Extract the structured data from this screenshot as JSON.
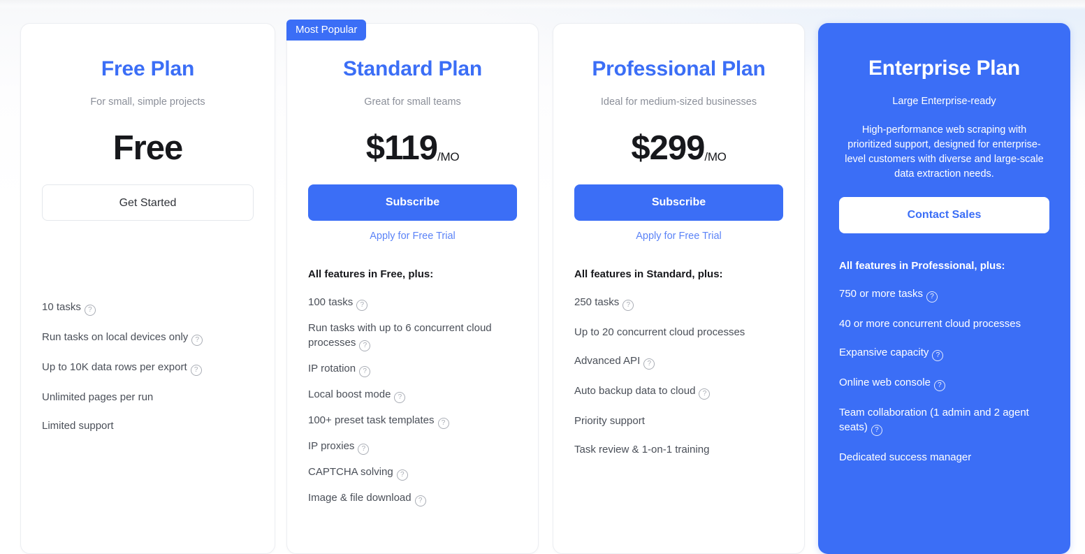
{
  "colors": {
    "brand_blue": "#3b6ef6",
    "link_blue": "#5b83f7",
    "text_dark": "#17181c",
    "text_body": "#4a4f58",
    "muted": "#8b8f99"
  },
  "help_icon_glyph": "?",
  "plans": [
    {
      "id": "free",
      "title": "Free Plan",
      "tagline": "For small, simple projects",
      "price_display": "Free",
      "price_unit": "",
      "cta_label": "Get Started",
      "cta_style": "outline",
      "trial_link": "",
      "features_head": "",
      "features": [
        {
          "text": "10 tasks",
          "help": true
        },
        {
          "text": "Run tasks on local devices only",
          "help": true
        },
        {
          "text": "Up to 10K data rows per export",
          "help": true
        },
        {
          "text": "Unlimited pages per run",
          "help": false
        },
        {
          "text": "Limited support",
          "help": false
        }
      ]
    },
    {
      "id": "standard",
      "badge": "Most Popular",
      "title": "Standard Plan",
      "tagline": "Great for small teams",
      "price_display": "$119",
      "price_unit": "/MO",
      "cta_label": "Subscribe",
      "cta_style": "primary",
      "trial_link": "Apply for Free Trial",
      "features_head": "All features in Free, plus:",
      "features": [
        {
          "text": "100 tasks",
          "help": true
        },
        {
          "text": "Run tasks with up to 6 concurrent cloud processes",
          "help": true
        },
        {
          "text": "IP rotation",
          "help": true
        },
        {
          "text": "Local boost mode",
          "help": true
        },
        {
          "text": "100+ preset task templates",
          "help": true
        },
        {
          "text": "IP proxies",
          "help": true
        },
        {
          "text": "CAPTCHA solving",
          "help": true
        },
        {
          "text": "Image & file download",
          "help": true
        }
      ]
    },
    {
      "id": "professional",
      "title": "Professional Plan",
      "tagline": "Ideal for medium-sized businesses",
      "price_display": "$299",
      "price_unit": "/MO",
      "cta_label": "Subscribe",
      "cta_style": "primary",
      "trial_link": "Apply for Free Trial",
      "features_head": "All features in Standard, plus:",
      "features": [
        {
          "text": "250 tasks",
          "help": true
        },
        {
          "text": "Up to 20 concurrent cloud processes",
          "help": false
        },
        {
          "text": "Advanced API",
          "help": true
        },
        {
          "text": "Auto backup data to cloud",
          "help": true
        },
        {
          "text": "Priority support",
          "help": false
        },
        {
          "text": "Task review & 1-on-1 training",
          "help": false
        }
      ]
    },
    {
      "id": "enterprise",
      "title": "Enterprise Plan",
      "tagline": "Large Enterprise-ready",
      "description": "High-performance web scraping with prioritized support, designed for enterprise-level customers with diverse and large-scale data extraction needs.",
      "cta_label": "Contact Sales",
      "cta_style": "white",
      "features_head": "All features in Professional, plus:",
      "features": [
        {
          "text": "750 or more tasks",
          "help": true
        },
        {
          "text": "40 or more concurrent cloud processes",
          "help": false
        },
        {
          "text": "Expansive capacity",
          "help": true
        },
        {
          "text": "Online web console",
          "help": true
        },
        {
          "text": "Team collaboration (1 admin and 2 agent seats)",
          "help": true
        },
        {
          "text": "Dedicated success manager",
          "help": false
        }
      ]
    }
  ]
}
